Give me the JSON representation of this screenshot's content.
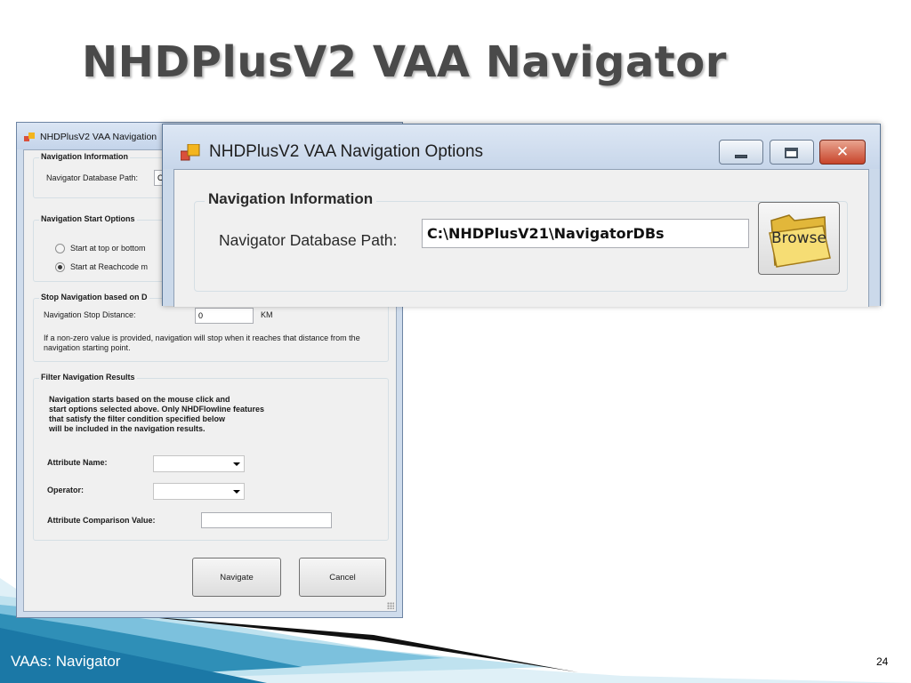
{
  "slide": {
    "title": "NHDPlusV2 VAA Navigator",
    "footer": "VAAs: Navigator",
    "page_number": "24"
  },
  "small_window": {
    "title": "NHDPlusV2 VAA Navigation",
    "nav_info": {
      "legend": "Navigation Information",
      "db_path_label": "Navigator Database Path:",
      "db_path_value": "C"
    },
    "start_options": {
      "legend": "Navigation Start Options",
      "option1": "Start at top or bottom",
      "option2": "Start at Reachcode m",
      "selected": 2
    },
    "stop_nav": {
      "legend": "Stop Navigation based on D",
      "distance_label": "Navigation Stop Distance:",
      "distance_value": "0",
      "unit": "KM",
      "note": "If a non-zero value is provided, navigation will stop when it reaches that distance from the navigation starting point."
    },
    "filter": {
      "legend": "Filter Navigation Results",
      "note_line1": "Navigation starts based on the mouse click and",
      "note_line2": "start options selected above.  Only NHDFlowline features",
      "note_line3": "that satisfy the filter condition specified below",
      "note_line4": "will be included in the navigation results.",
      "attr_name_label": "Attribute Name:",
      "attr_name_value": "",
      "operator_label": "Operator:",
      "operator_value": "",
      "comparison_label": "Attribute Comparison Value:",
      "comparison_value": ""
    },
    "buttons": {
      "navigate": "Navigate",
      "cancel": "Cancel"
    }
  },
  "large_window": {
    "title": "NHDPlusV2 VAA Navigation Options",
    "legend": "Navigation Information",
    "db_path_label": "Navigator Database Path:",
    "db_path_value": "C:\\NHDPlusV21\\NavigatorDBs",
    "browse_label": "Browse"
  },
  "colors": {
    "title_gray": "#4a4a4a",
    "footer_teal": "#2f8fb7",
    "window_frame": "#cbd9ea",
    "close_red": "#c7442a"
  },
  "icons": [
    "app-icon",
    "minimize-icon",
    "maximize-icon",
    "close-icon",
    "folder-icon",
    "dropdown-arrow-icon",
    "resize-grip-icon"
  ]
}
